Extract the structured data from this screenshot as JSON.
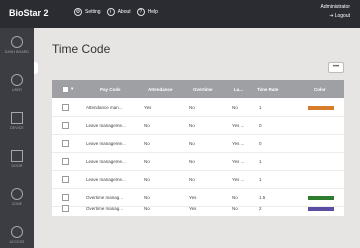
{
  "header": {
    "brand": "BioStar 2",
    "nav": [
      {
        "label": "Setting",
        "icon": "gear-icon"
      },
      {
        "label": "About",
        "icon": "info-icon"
      },
      {
        "label": "Help",
        "icon": "help-icon"
      }
    ],
    "user": "Administrator",
    "logout": "Logout"
  },
  "sidebar": {
    "items": [
      {
        "label": "DASH BOARD",
        "icon": "dashboard-icon"
      },
      {
        "label": "USER",
        "icon": "user-icon"
      },
      {
        "label": "DEVICE",
        "icon": "device-icon"
      },
      {
        "label": "DOOR",
        "icon": "door-icon"
      },
      {
        "label": "ZONE",
        "icon": "zone-icon"
      },
      {
        "label": "ACCESS",
        "icon": "access-icon"
      }
    ]
  },
  "page": {
    "title": "Time Code",
    "more_label": "•••"
  },
  "table": {
    "headers": [
      "Pay Code",
      "Attendance",
      "Overtime",
      "La...",
      "Time Rate",
      "Color"
    ],
    "rows": [
      {
        "pay_code": "Attendance man...",
        "attendance": "Yes",
        "overtime": "No",
        "la": "No",
        "time_rate": "1",
        "color": "#d77d2a"
      },
      {
        "pay_code": "Leave manageme...",
        "attendance": "No",
        "overtime": "No",
        "la": "Yes ...",
        "time_rate": "0",
        "color": ""
      },
      {
        "pay_code": "Leave manageme...",
        "attendance": "No",
        "overtime": "No",
        "la": "Yes ...",
        "time_rate": "0",
        "color": ""
      },
      {
        "pay_code": "Leave manageme...",
        "attendance": "No",
        "overtime": "No",
        "la": "Yes ...",
        "time_rate": "1",
        "color": ""
      },
      {
        "pay_code": "Leave manageme...",
        "attendance": "No",
        "overtime": "No",
        "la": "Yes ...",
        "time_rate": "1",
        "color": ""
      },
      {
        "pay_code": "Overtime manag...",
        "attendance": "No",
        "overtime": "Yes",
        "la": "No",
        "time_rate": "1.5",
        "color": "#2e7d2e"
      },
      {
        "pay_code": "Overtime manag...",
        "attendance": "No",
        "overtime": "Yes",
        "la": "No",
        "time_rate": "2",
        "color": "#5b4da3"
      }
    ]
  }
}
